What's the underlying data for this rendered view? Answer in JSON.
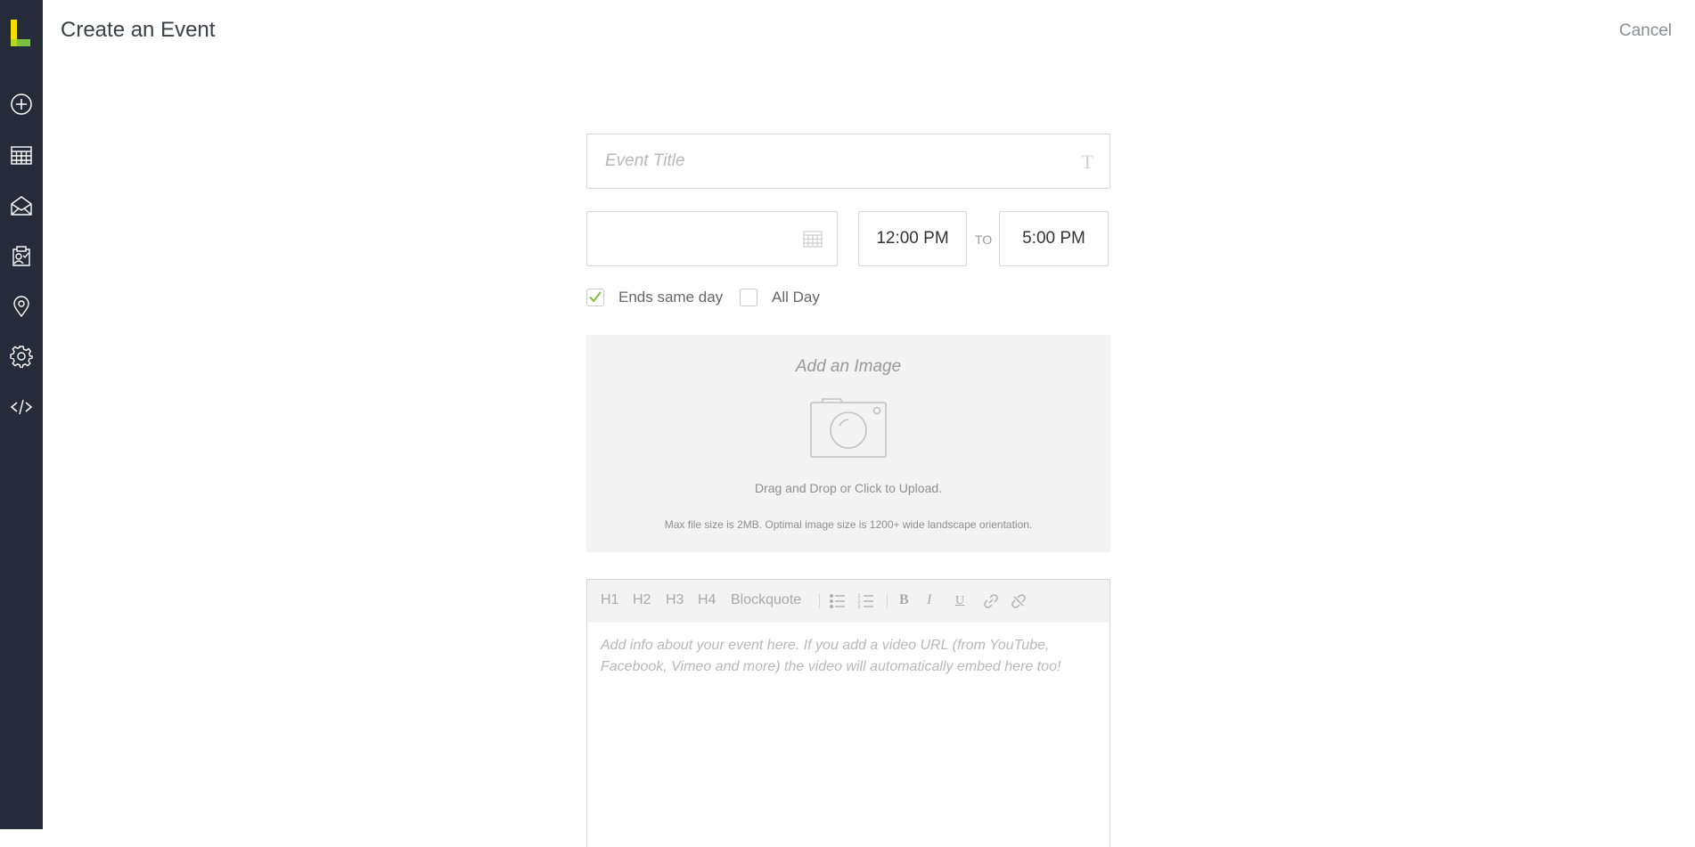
{
  "header": {
    "title": "Create an Event",
    "cancel_label": "Cancel"
  },
  "sidebar": {
    "logo": "L",
    "items": [
      {
        "icon": "plus-circle-icon"
      },
      {
        "icon": "calendar-grid-icon"
      },
      {
        "icon": "envelope-icon"
      },
      {
        "icon": "clipboard-check-icon"
      },
      {
        "icon": "location-pin-icon"
      },
      {
        "icon": "gear-icon"
      },
      {
        "icon": "code-icon"
      }
    ]
  },
  "form": {
    "title_placeholder": "Event Title",
    "date_value": "",
    "start_time": "12:00 PM",
    "to_label": "TO",
    "end_time": "5:00 PM",
    "ends_same_day": {
      "label": "Ends same day",
      "checked": true
    },
    "all_day": {
      "label": "All Day",
      "checked": false
    }
  },
  "upload": {
    "title": "Add an Image",
    "hint": "Drag and Drop or Click to Upload.",
    "note": "Max file size is 2MB. Optimal image size is 1200+ wide landscape orientation."
  },
  "editor": {
    "toolbar": {
      "h1": "H1",
      "h2": "H2",
      "h3": "H3",
      "h4": "H4",
      "blockquote": "Blockquote",
      "bold": "B",
      "italic": "I",
      "underline": "U"
    },
    "placeholder": "Add info about your event here. If you add a video URL (from YouTube, Facebook, Vimeo and more) the video will automatically embed here too!"
  },
  "colors": {
    "sidebar_bg": "#262b3a",
    "accent_green": "#7ac142",
    "logo_yellow": "#f4e000"
  }
}
